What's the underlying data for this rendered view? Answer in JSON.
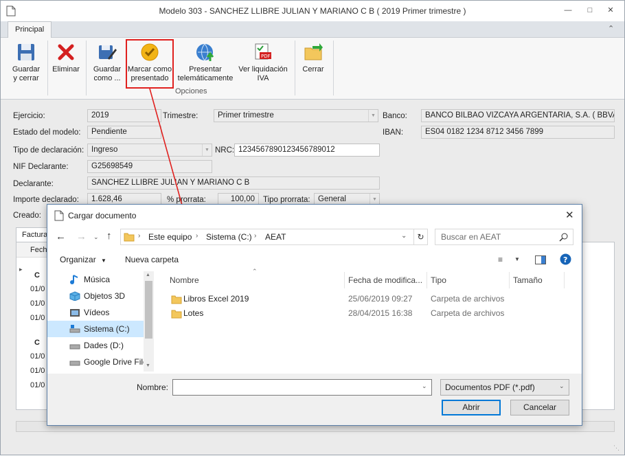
{
  "window": {
    "title": "Modelo 303 - SANCHEZ LLIBRE JULIAN Y MARIANO C B ( 2019 Primer trimestre )"
  },
  "ribbon": {
    "tab": "Principal",
    "buttons": [
      {
        "label1": "Guardar",
        "label2": "y cerrar"
      },
      {
        "label1": "Eliminar",
        "label2": ""
      },
      {
        "label1": "Guardar",
        "label2": "como ..."
      },
      {
        "label1": "Marcar como",
        "label2": "presentado"
      },
      {
        "label1": "Presentar",
        "label2": "telemáticamente"
      },
      {
        "label1": "Ver liquidación",
        "label2": "IVA"
      },
      {
        "label1": "Cerrar",
        "label2": ""
      }
    ],
    "group_label": "Opciones"
  },
  "form": {
    "ejercicio_label": "Ejercicio:",
    "ejercicio": "2019",
    "trimestre_label": "Trimestre:",
    "trimestre": "Primer trimestre",
    "banco_label": "Banco:",
    "banco": "BANCO BILBAO VIZCAYA ARGENTARIA, S.A. ( BBVAESMM",
    "estado_label": "Estado del modelo:",
    "estado": "Pendiente",
    "iban_label": "IBAN:",
    "iban": "ES04 0182 1234 8712 3456 7899",
    "tipo_label": "Tipo de declaración:",
    "tipo": "Ingreso",
    "nrc_label": "NRC:",
    "nrc": "1234567890123456789012",
    "nif_label": "NIF Declarante:",
    "nif": "G25698549",
    "declarante_label": "Declarante:",
    "declarante": "SANCHEZ LLIBRE JULIAN Y MARIANO C B",
    "importe_label": "Importe declarado:",
    "importe": "1.628,46",
    "prorrata_label": "% prorrata:",
    "prorrata": "100,00",
    "tipo_prorrata_label": "Tipo prorrata:",
    "tipo_prorrata": "General",
    "creado_label": "Creado:"
  },
  "background_grid": {
    "tab": "Factura",
    "col": "Fecha",
    "group_letter": "C",
    "rows": [
      "01/0",
      "01/0",
      "01/0",
      "01/0",
      "01/0",
      "01/0"
    ]
  },
  "dialog": {
    "title": "Cargar documento",
    "breadcrumb": [
      "Este equipo",
      "Sistema (C:)",
      "AEAT"
    ],
    "search_placeholder": "Buscar en AEAT",
    "organize": "Organizar",
    "new_folder": "Nueva carpeta",
    "nav_items": [
      {
        "label": "Música",
        "icon": "music-icon"
      },
      {
        "label": "Objetos 3D",
        "icon": "cube-icon"
      },
      {
        "label": "Vídeos",
        "icon": "video-icon"
      },
      {
        "label": "Sistema (C:)",
        "icon": "drive-icon"
      },
      {
        "label": "Dades (D:)",
        "icon": "drive-icon"
      },
      {
        "label": "Google Drive File",
        "icon": "drive-icon"
      }
    ],
    "columns": [
      "Nombre",
      "Fecha de modifica...",
      "Tipo",
      "Tamaño"
    ],
    "files": [
      {
        "name": "Libros Excel 2019",
        "date": "25/06/2019 09:27",
        "type": "Carpeta de archivos",
        "size": ""
      },
      {
        "name": "Lotes",
        "date": "28/04/2015 16:38",
        "type": "Carpeta de archivos",
        "size": ""
      }
    ],
    "filename_label": "Nombre:",
    "filename": "",
    "filter": "Documentos PDF (*.pdf)",
    "open": "Abrir",
    "cancel": "Cancelar"
  },
  "colors": {
    "highlight": "#e0201e",
    "accent": "#0078d7",
    "folder": "#f3c75c"
  }
}
